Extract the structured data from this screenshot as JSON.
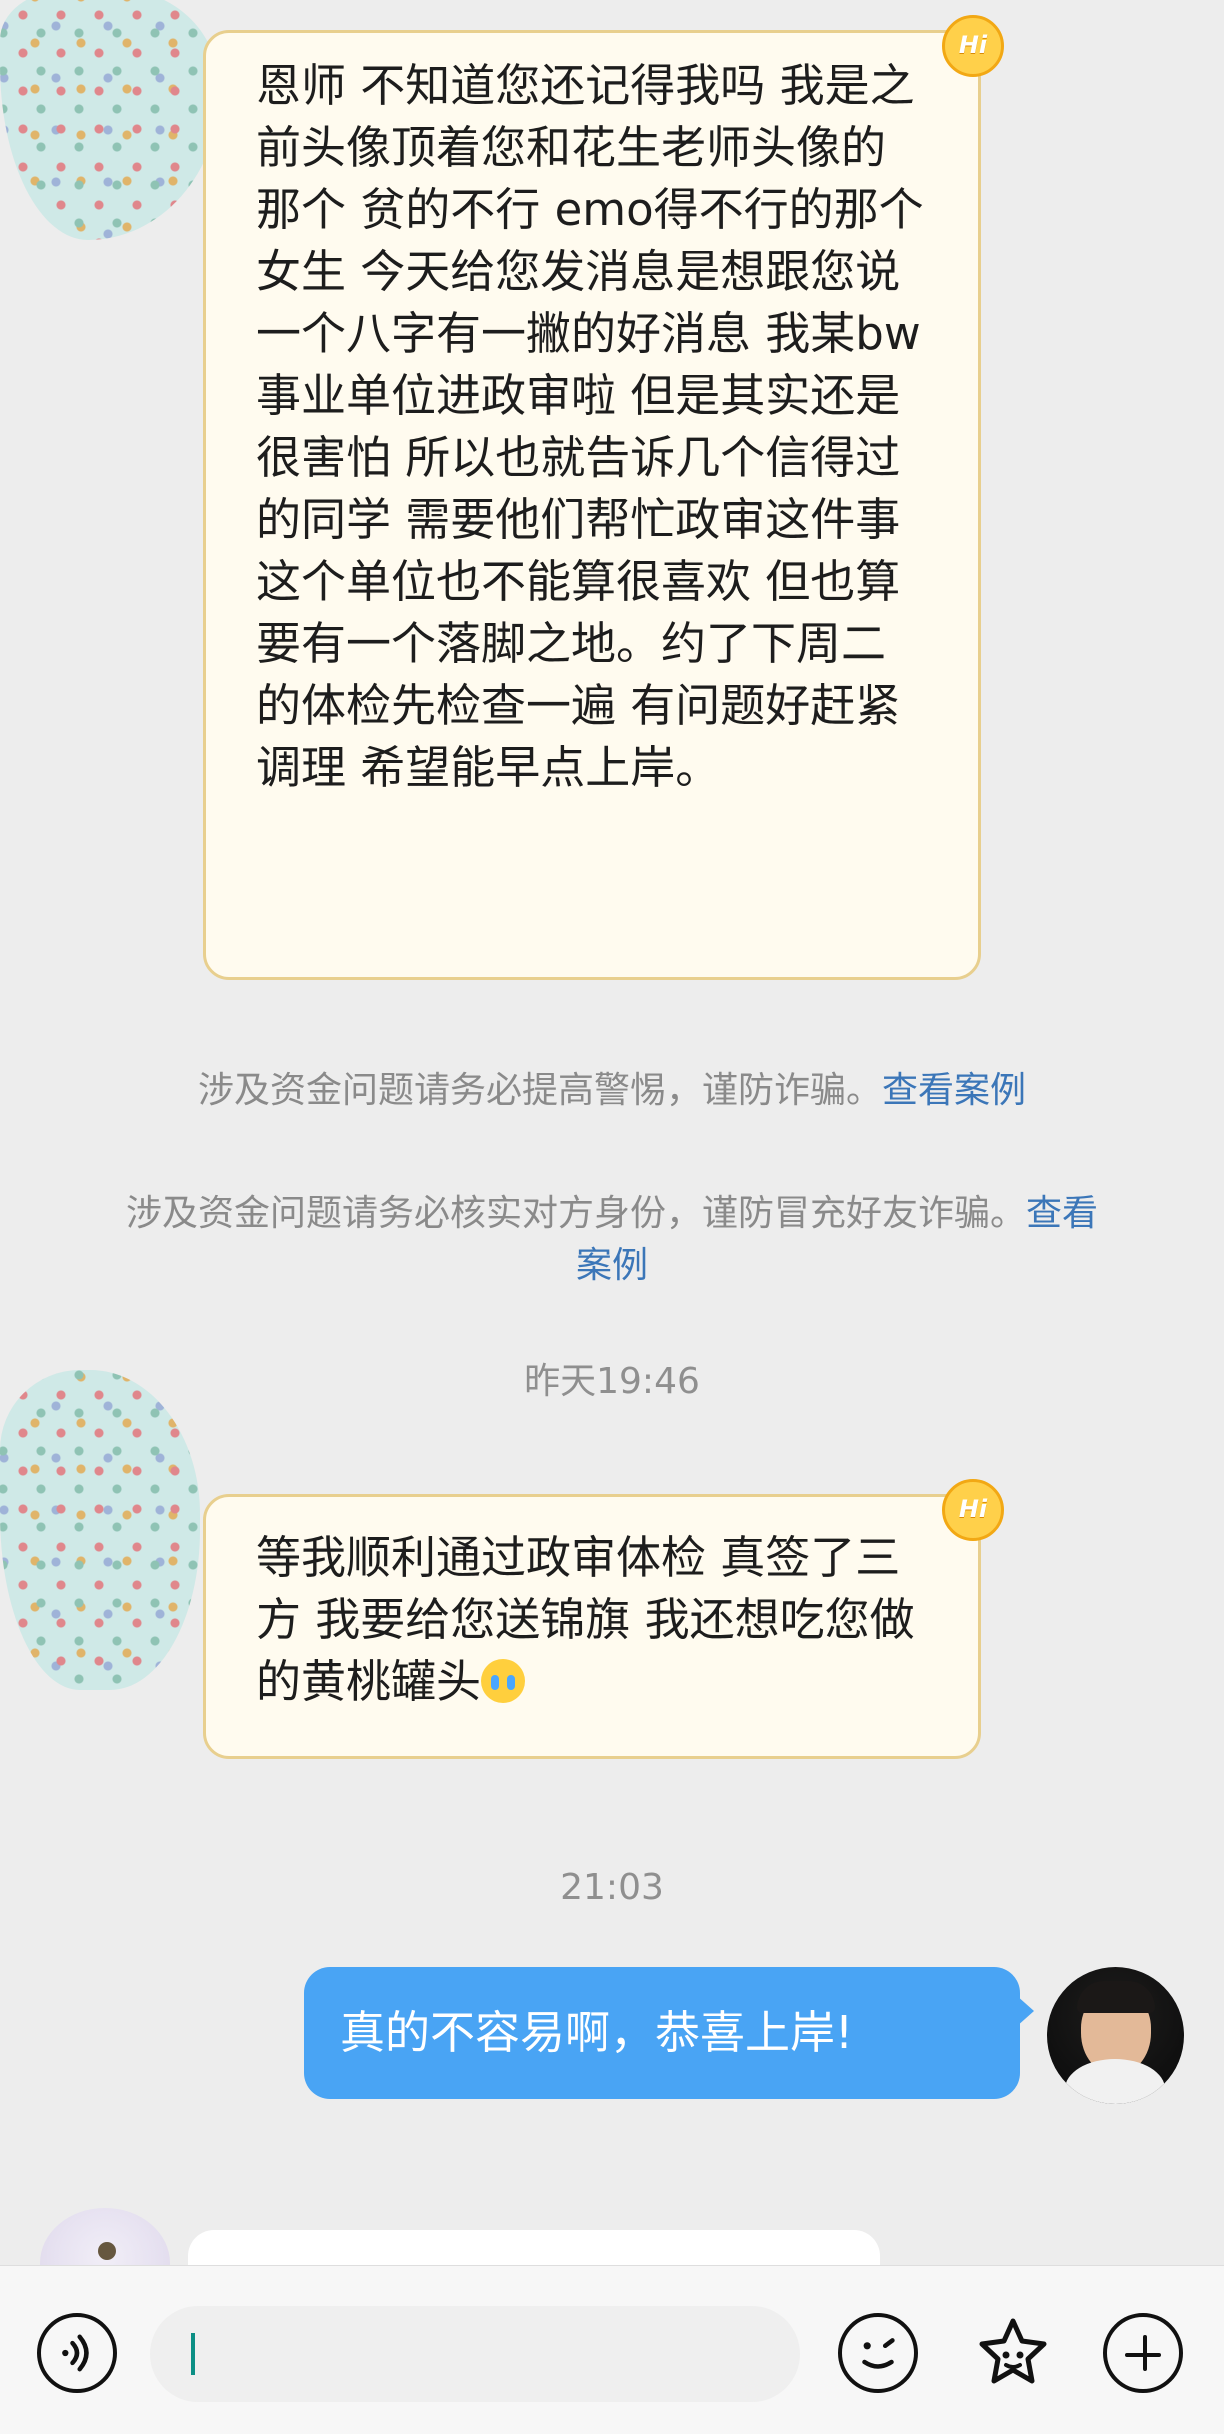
{
  "messages": {
    "incoming_1": "恩师 不知道您还记得我吗 我是之前头像顶着您和花生老师头像的 那个 贫的不行 emo得不行的那个女生 今天给您发消息是想跟您说一个八字有一撇的好消息 我某bw事业单位进政审啦 但是其实还是很害怕 所以也就告诉几个信得过的同学 需要他们帮忙政审这件事 这个单位也不能算很喜欢 但也算要有一个落脚之地。约了下周二的体检先检查一遍 有问题好赶紧调理 希望能早点上岸。",
    "notice_1": "涉及资金问题请务必提高警惕，谨防诈骗。",
    "notice_1_link": "查看案例",
    "notice_2": "涉及资金问题请务必核实对方身份，谨防冒充好友诈骗。",
    "notice_2_link": "查看案例",
    "time_1": "昨天19:46",
    "incoming_2": "等我顺利通过政审体检 真签了三方 我要给您送锦旗 我还想吃您做的黄桃罐头",
    "time_2": "21:03",
    "outgoing_1": "真的不容易啊，恭喜上岸!"
  },
  "bubble_badge": "Hi",
  "input": {
    "placeholder": "",
    "value": ""
  },
  "icons": {
    "voice": "voice-icon",
    "emoji": "emoji-icon",
    "favorite": "favorite-icon",
    "plus": "plus-icon",
    "crying_emoji": "crying-emoji-icon"
  },
  "colors": {
    "incoming_bubble": "#fffbef",
    "incoming_border": "#e8cf8e",
    "outgoing_bubble": "#49a4f4",
    "link": "#3b76b8"
  }
}
